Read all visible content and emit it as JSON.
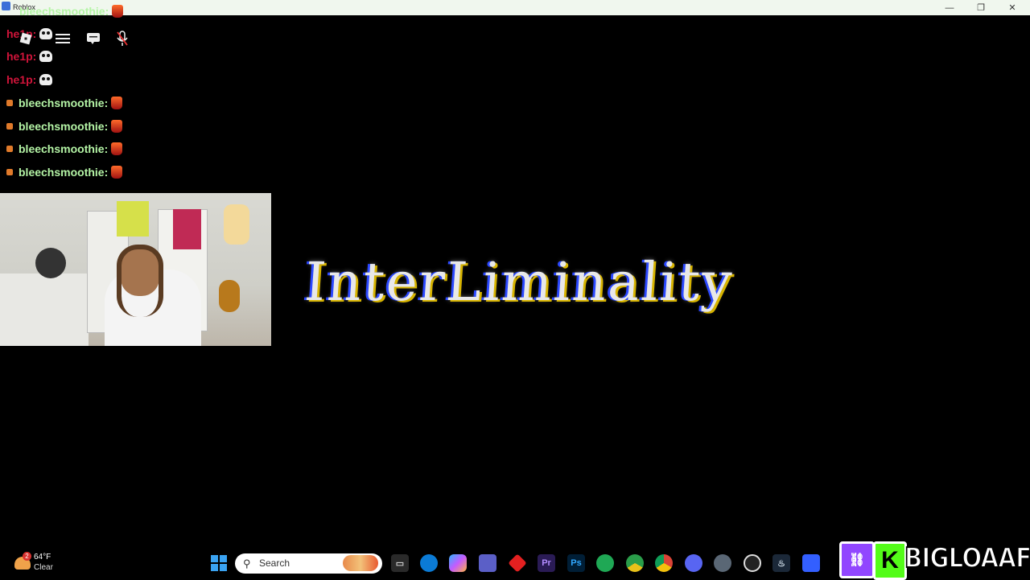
{
  "window": {
    "title": "Roblox",
    "minimize_glyph": "—",
    "restore_glyph": "❐",
    "close_glyph": "✕"
  },
  "chat": {
    "messages": [
      {
        "author": "bleechsmoothie:",
        "emoji": "fire",
        "style": "bleech"
      },
      {
        "author": "he1p:",
        "emoji": "skull",
        "style": "help"
      },
      {
        "author": "he1p:",
        "emoji": "skull",
        "style": "help"
      },
      {
        "author": "he1p:",
        "emoji": "skull",
        "style": "help"
      },
      {
        "author": "bleechsmoothie:",
        "emoji": "fire",
        "style": "bleech"
      },
      {
        "author": "bleechsmoothie:",
        "emoji": "fire",
        "style": "bleech"
      },
      {
        "author": "bleechsmoothie:",
        "emoji": "fire",
        "style": "bleech"
      },
      {
        "author": "bleechsmoothie:",
        "emoji": "fire",
        "style": "bleech"
      }
    ]
  },
  "roblox_icons": [
    "roblox-logo-icon",
    "menu-icon",
    "chat-icon",
    "mic-muted-icon"
  ],
  "game": {
    "title": "InterLiminality"
  },
  "taskbar": {
    "weather_temp": "64°F",
    "weather_condition": "Clear",
    "weather_badge": "2",
    "search_label": "Search",
    "icons": [
      "start-icon",
      "task-view-icon",
      "edge-icon",
      "copilot-icon",
      "teams-icon",
      "red-app-icon",
      "premiere-icon",
      "photoshop-icon",
      "whatsapp-icon",
      "chrome-green-icon",
      "chrome-icon",
      "discord-icon",
      "settings-icon",
      "obs-icon",
      "steam-icon",
      "roblox-icon"
    ]
  },
  "branding": {
    "twitch_label": "⛓",
    "kick_label": "K",
    "handle": "BIGLOAAF"
  },
  "colors": {
    "help_name": "#d0143a",
    "bleech_name": "#b5f5a6",
    "twitch": "#9146ff",
    "kick": "#53fc18"
  }
}
